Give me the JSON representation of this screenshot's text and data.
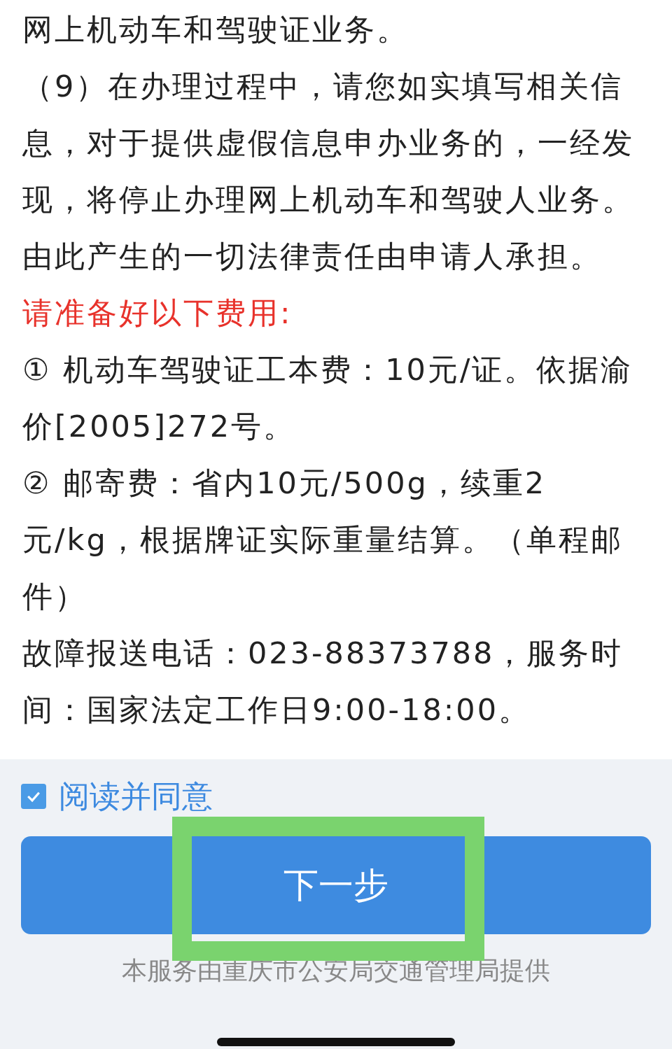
{
  "paragraphs": [
    {
      "kind": "text",
      "text": "网上机动车和驾驶证业务。"
    },
    {
      "kind": "text",
      "text": "（9）在办理过程中，请您如实填写相关信息，对于提供虚假信息申办业务的，一经发现，将停止办理网上机动车和驾驶人业务。由此产生的一切法律责任由申请人承担。"
    },
    {
      "kind": "heading",
      "text": "请准备好以下费用:"
    },
    {
      "kind": "text",
      "text": "① 机动车驾驶证工本费：10元/证。依据渝价[2005]272号。"
    },
    {
      "kind": "text",
      "text": "② 邮寄费：省内10元/500g，续重2\n元/kg，根据牌证实际重量结算。（单程邮件）"
    },
    {
      "kind": "text",
      "text": "故障报送电话：023-88373788，服务时间：国家法定工作日9:00-18:00。"
    }
  ],
  "agreement": {
    "label": "阅读并同意",
    "checked": true
  },
  "next_button": {
    "label": "下一步",
    "highlighted": true
  },
  "footer": "本服务由重庆市公安局交通管理局提供"
}
